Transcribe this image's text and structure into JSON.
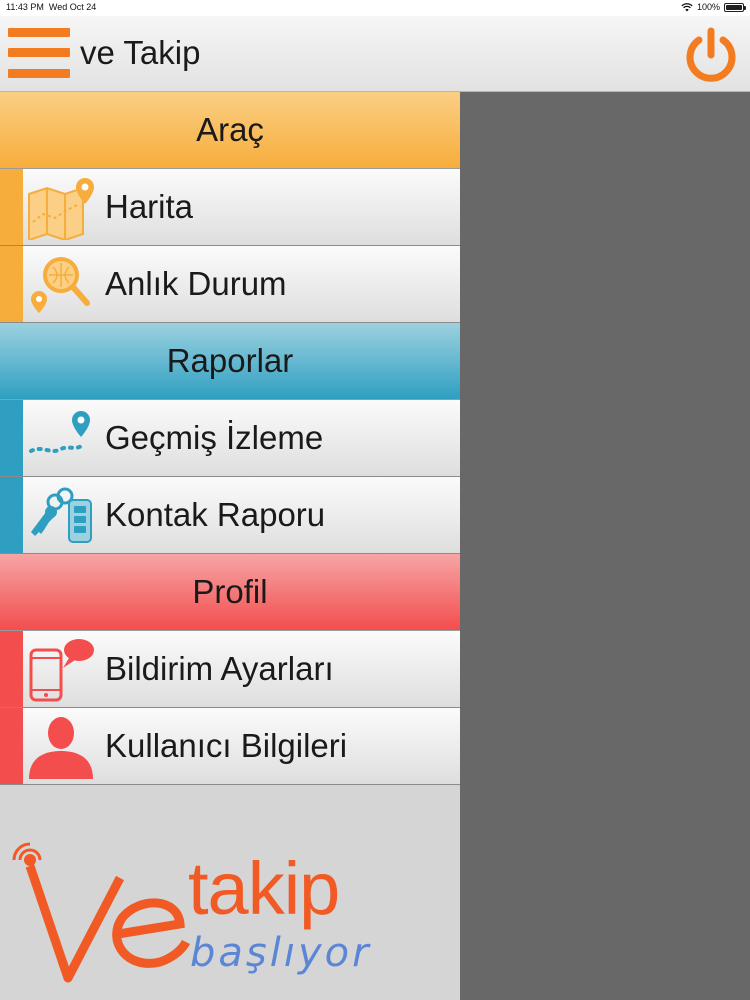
{
  "status_bar": {
    "time": "11:43 PM",
    "date": "Wed Oct 24",
    "battery": "100%"
  },
  "header": {
    "title": "ve Takip",
    "menu_icon": "hamburger-menu-icon",
    "power_icon": "power-icon",
    "accent_color": "#f47c20"
  },
  "sections": [
    {
      "title": "Araç",
      "color": "#f7ad3b",
      "items": [
        {
          "label": "Harita",
          "icon": "map-icon"
        },
        {
          "label": "Anlık Durum",
          "icon": "location-search-icon"
        }
      ]
    },
    {
      "title": "Raporlar",
      "color": "#2f9fc1",
      "items": [
        {
          "label": "Geçmiş İzleme",
          "icon": "route-icon"
        },
        {
          "label": "Kontak Raporu",
          "icon": "car-key-icon"
        }
      ]
    },
    {
      "title": "Profil",
      "color": "#f34d4e",
      "items": [
        {
          "label": "Bildirim Ayarları",
          "icon": "phone-notification-icon"
        },
        {
          "label": "Kullanıcı Bilgileri",
          "icon": "user-icon"
        }
      ]
    }
  ],
  "logo": {
    "text": "Vetakip",
    "tagline": "başlıyor"
  }
}
